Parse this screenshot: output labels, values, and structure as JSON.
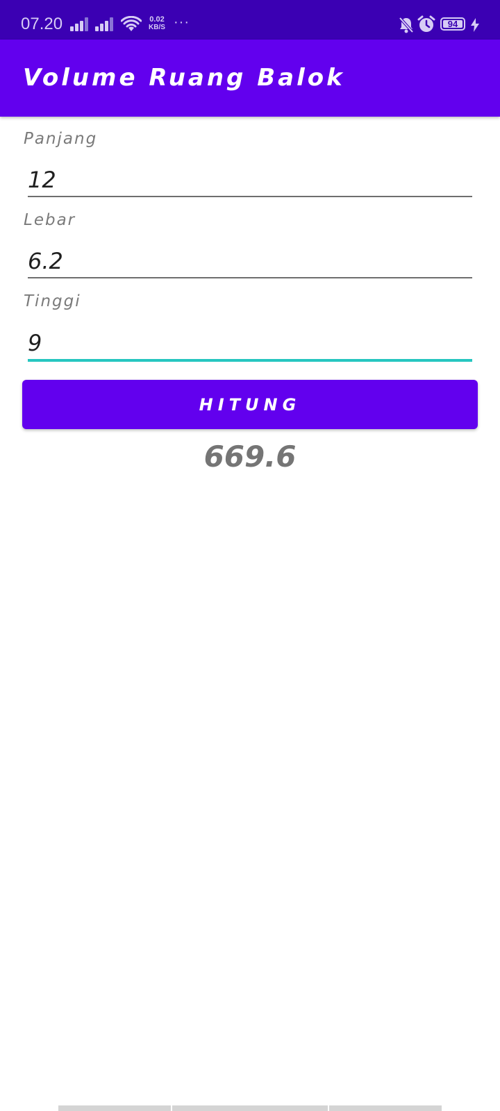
{
  "status_bar": {
    "time": "07.20",
    "net_speed_value": "0.02",
    "net_speed_unit": "KB/S",
    "more": "···",
    "battery_level": "94",
    "icons": [
      "signal-icon",
      "signal-icon",
      "wifi-icon",
      "mute-notification-icon",
      "alarm-icon",
      "battery-icon",
      "charging-icon"
    ]
  },
  "app_bar": {
    "title": "Volume Ruang Balok"
  },
  "form": {
    "panjang": {
      "label": "Panjang",
      "value": "12"
    },
    "lebar": {
      "label": "Lebar",
      "value": "6.2"
    },
    "tinggi": {
      "label": "Tinggi",
      "value": "9"
    }
  },
  "button": {
    "label": "HITUNG"
  },
  "result": {
    "value": "669.6"
  },
  "colors": {
    "primary": "#6200ee",
    "status_bar": "#3b00b3",
    "focus_underline": "#26c6c0",
    "label_gray": "#7a7a7a",
    "result_gray": "#757575"
  }
}
